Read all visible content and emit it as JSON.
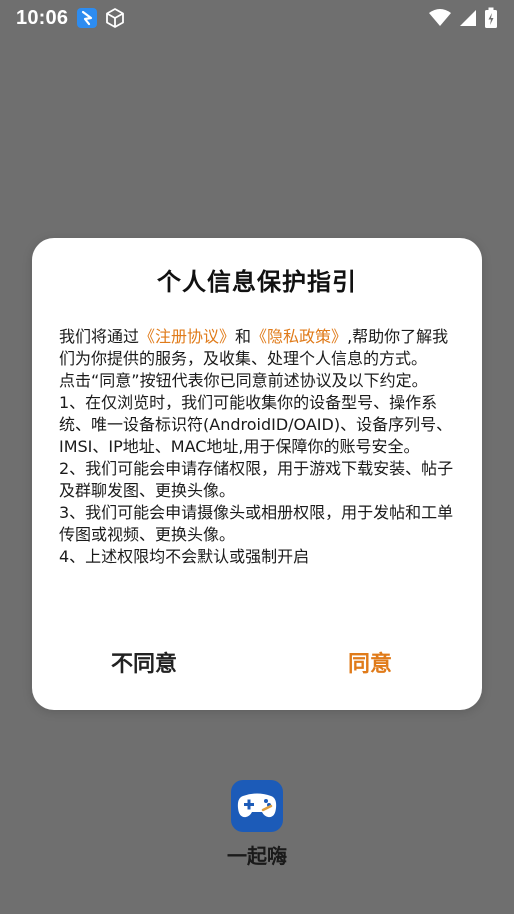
{
  "status_bar": {
    "time": "10:06",
    "left_icons": [
      "app-notification-icon",
      "cube-icon"
    ],
    "right_icons": [
      "wifi-icon",
      "cell-signal-icon",
      "battery-charging-icon"
    ]
  },
  "dialog": {
    "title": "个人信息保护指引",
    "body": {
      "intro_prefix": "我们将通过",
      "link_terms": "《注册协议》",
      "intro_and": "和",
      "link_privacy": "《隐私政策》",
      "intro_suffix": ",帮助你了解我们为你提供的服务，及收集、处理个人信息的方式。",
      "consent_note": " 点击“同意”按钮代表你已同意前述协议及以下约定。",
      "item1": " 1、在仅浏览时，我们可能收集你的设备型号、操作系统、唯一设备标识符(AndroidID/OAID)、设备序列号、IMSI、IP地址、MAC地址,用于保障你的账号安全。",
      "item2": " 2、我们可能会申请存储权限，用于游戏下载安装、帖子及群聊发图、更换头像。",
      "item3": " 3、我们可能会申请摄像头或相册权限，用于发帖和工单传图或视频、更换头像。",
      "item4": " 4、上述权限均不会默认或强制开启"
    },
    "buttons": {
      "disagree": "不同意",
      "agree": "同意"
    }
  },
  "app": {
    "name": "一起嗨",
    "icon": "gamepad-icon"
  },
  "colors": {
    "scrim": "#6f6f6f",
    "accent": "#e07b1a",
    "app_icon_bg": "#1c5bb8"
  }
}
